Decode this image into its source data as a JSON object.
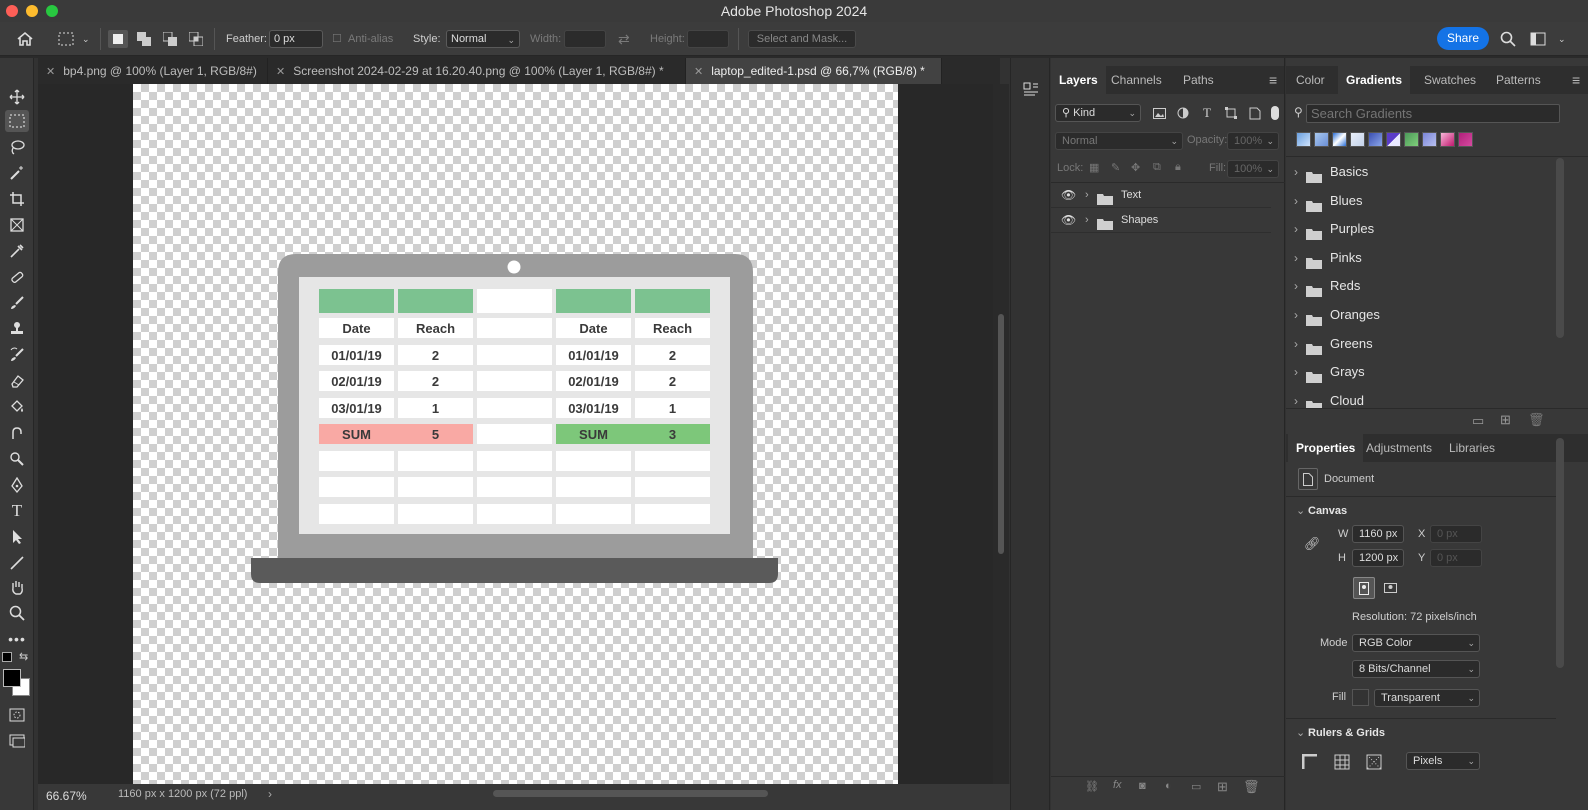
{
  "app": {
    "title": "Adobe Photoshop 2024"
  },
  "options_bar": {
    "feather_label": "Feather:",
    "feather_value": "0 px",
    "anti_alias_label": "Anti-alias",
    "style_label": "Style:",
    "style_value": "Normal",
    "width_label": "Width:",
    "height_label": "Height:",
    "select_mask_label": "Select and Mask...",
    "share_label": "Share"
  },
  "doc_tabs": [
    {
      "label": "bp4.png @ 100% (Layer 1, RGB/8#)"
    },
    {
      "label": "Screenshot 2024-02-29 at 16.20.40.png @ 100% (Layer 1, RGB/8#) *"
    },
    {
      "label": "laptop_edited-1.psd @ 66,7% (RGB/8) *"
    }
  ],
  "canvas_table": {
    "headers": [
      "Date",
      "Reach",
      "",
      "Date",
      "Reach"
    ],
    "rows": [
      [
        "01/01/19",
        "2",
        "",
        "01/01/19",
        "2"
      ],
      [
        "02/01/19",
        "2",
        "",
        "02/01/19",
        "2"
      ],
      [
        "03/01/19",
        "1",
        "",
        "03/01/19",
        "1"
      ]
    ],
    "sum_label_left": "SUM",
    "sum_value_left": "5",
    "sum_label_right": "SUM",
    "sum_value_right": "3"
  },
  "status": {
    "zoom": "66.67%",
    "doc_info": "1160 px x 1200 px (72 ppl)"
  },
  "layers_panel": {
    "tabs": [
      "Layers",
      "Channels",
      "Paths"
    ],
    "filter_kind": "Kind",
    "blend_mode": "Normal",
    "opacity_label": "Opacity:",
    "opacity_value": "100%",
    "lock_label": "Lock:",
    "fill_label": "Fill:",
    "fill_value": "100%",
    "layers": [
      {
        "name": "Text"
      },
      {
        "name": "Shapes"
      }
    ]
  },
  "gradients_panel": {
    "tabs": [
      "Color",
      "Gradients",
      "Swatches",
      "Patterns"
    ],
    "search_placeholder": "Search Gradients",
    "groups": [
      "Basics",
      "Blues",
      "Purples",
      "Pinks",
      "Reds",
      "Oranges",
      "Greens",
      "Grays",
      "Cloud"
    ]
  },
  "properties_panel": {
    "tabs": [
      "Properties",
      "Adjustments",
      "Libraries"
    ],
    "doc_label": "Document",
    "canvas_section": "Canvas",
    "w_label": "W",
    "w_value": "1160 px",
    "h_label": "H",
    "h_value": "1200 px",
    "x_label": "X",
    "x_placeholder": "0 px",
    "y_label": "Y",
    "y_placeholder": "0 px",
    "resolution": "Resolution: 72 pixels/inch",
    "mode_label": "Mode",
    "mode_value": "RGB Color",
    "bits_value": "8 Bits/Channel",
    "fill_label": "Fill",
    "fill_value": "Transparent",
    "rulers_section": "Rulers & Grids",
    "units_value": "Pixels"
  },
  "colors": {
    "accent": "#1473e6",
    "table_green": "#7cc290",
    "sum_red": "#f9a9a4",
    "sum_green": "#7dc77a"
  }
}
